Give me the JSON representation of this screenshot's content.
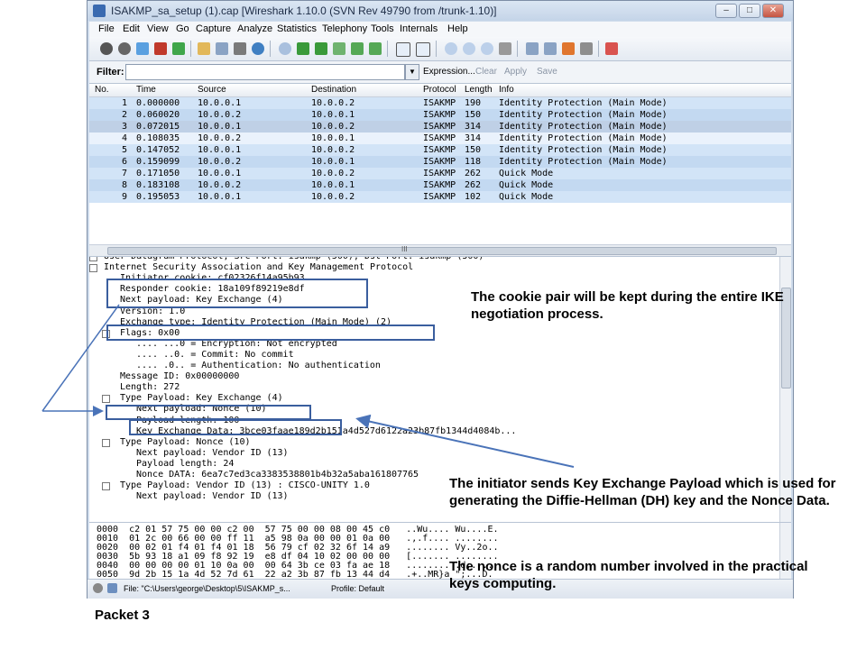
{
  "window": {
    "title": "ISAKMP_sa_setup (1).cap   [Wireshark 1.10.0  (SVN Rev 49790 from /trunk-1.10)]",
    "minimize": "–",
    "maximize": "□",
    "close": "✕"
  },
  "menu": [
    "File",
    "Edit",
    "View",
    "Go",
    "Capture",
    "Analyze",
    "Statistics",
    "Telephony",
    "Tools",
    "Internals",
    "Help"
  ],
  "filter": {
    "label": "Filter:",
    "value": "",
    "dropdown": "▼",
    "expression": "Expression...",
    "clear": "Clear",
    "apply": "Apply",
    "save": "Save"
  },
  "columns": [
    "No.",
    "Time",
    "Source",
    "Destination",
    "Protocol",
    "Length",
    "Info"
  ],
  "packets": [
    {
      "no": "1",
      "time": "0.000000",
      "src": "10.0.0.1",
      "dst": "10.0.0.2",
      "proto": "ISAKMP",
      "len": "190",
      "info": "Identity Protection (Main Mode)"
    },
    {
      "no": "2",
      "time": "0.060020",
      "src": "10.0.0.2",
      "dst": "10.0.0.1",
      "proto": "ISAKMP",
      "len": "150",
      "info": "Identity Protection (Main Mode)"
    },
    {
      "no": "3",
      "time": "0.072015",
      "src": "10.0.0.1",
      "dst": "10.0.0.2",
      "proto": "ISAKMP",
      "len": "314",
      "info": "Identity Protection (Main Mode)"
    },
    {
      "no": "4",
      "time": "0.108035",
      "src": "10.0.0.2",
      "dst": "10.0.0.1",
      "proto": "ISAKMP",
      "len": "314",
      "info": "Identity Protection (Main Mode)"
    },
    {
      "no": "5",
      "time": "0.147052",
      "src": "10.0.0.1",
      "dst": "10.0.0.2",
      "proto": "ISAKMP",
      "len": "150",
      "info": "Identity Protection (Main Mode)"
    },
    {
      "no": "6",
      "time": "0.159099",
      "src": "10.0.0.2",
      "dst": "10.0.0.1",
      "proto": "ISAKMP",
      "len": "118",
      "info": "Identity Protection (Main Mode)"
    },
    {
      "no": "7",
      "time": "0.171050",
      "src": "10.0.0.1",
      "dst": "10.0.0.2",
      "proto": "ISAKMP",
      "len": "262",
      "info": "Quick Mode"
    },
    {
      "no": "8",
      "time": "0.183108",
      "src": "10.0.0.2",
      "dst": "10.0.0.1",
      "proto": "ISAKMP",
      "len": "262",
      "info": "Quick Mode"
    },
    {
      "no": "9",
      "time": "0.195053",
      "src": "10.0.0.1",
      "dst": "10.0.0.2",
      "proto": "ISAKMP",
      "len": "102",
      "info": "Quick Mode"
    }
  ],
  "row_colors": [
    "#d2e4f7",
    "#c3d9f1",
    "#bfd0e6",
    "#eaf2fc",
    "#d2e4f7",
    "#c3d9f1",
    "#d2e4f7",
    "#c3d9f1",
    "#d2e4f7"
  ],
  "hscroll_grip": "III",
  "details": [
    "User Datagram Protocol, Src Port: isakmp (500), Dst Port: isakmp (500)",
    "Internet Security Association and Key Management Protocol",
    "Initiator cookie: cf02326f14a95b93",
    "Responder cookie: 18a109f89219e8df",
    "Next payload: Key Exchange (4)",
    "Version: 1.0",
    "Exchange type: Identity Protection (Main Mode) (2)",
    "Flags: 0x00",
    ".... ...0 = Encryption: Not encrypted",
    ".... ..0. = Commit: No commit",
    ".... .0.. = Authentication: No authentication",
    "Message ID: 0x00000000",
    "Length: 272",
    "Type Payload: Key Exchange (4)",
    "Next payload: Nonce (10)",
    "Payload length: 100",
    "Key Exchange Data: 3bce03faae189d2b151a4d527d6122a23b87fb1344d4084b...",
    "Type Payload: Nonce (10)",
    "Next payload: Vendor ID (13)",
    "Payload length: 24",
    "Nonce DATA: 6ea7c7ed3ca3383538801b4b32a5aba161807765",
    "Type Payload: Vendor ID (13) : CISCO-UNITY 1.0",
    "Next payload: Vendor ID (13)"
  ],
  "hex": [
    "0000  c2 01 57 75 00 00 c2 00  57 75 00 00 08 00 45 c0   ..Wu.... Wu....E.",
    "0010  01 2c 00 66 00 00 ff 11  a5 98 0a 00 00 01 0a 00   .,.f.... ........",
    "0020  00 02 01 f4 01 f4 01 18  56 79 cf 02 32 6f 14 a9   ........ Vy..2o..",
    "0030  5b 93 18 a1 09 f8 92 19  e8 df 04 10 02 00 00 00   [....... ........",
    "0040  00 00 00 00 01 10 0a 00  00 64 3b ce 03 fa ae 18   ........ .d;.....",
    "0050  9d 2b 15 1a 4d 52 7d 61  22 a2 3b 87 fb 13 44 d4   .+..MR}a \";...D."
  ],
  "status": {
    "file": "File: \"C:\\Users\\george\\Desktop\\5\\ISAKMP_s...",
    "profile": "Profile: Default"
  },
  "annotations": {
    "cookie": "The cookie pair will be kept during the entire IKE negotiation process.",
    "keyexchange": "The initiator sends Key Exchange Payload which is used for generating the Diffie-Hellman (DH) key and the Nonce Data.",
    "nonce": "The nonce is a random number involved in the practical keys computing."
  },
  "caption": "Packet 3"
}
